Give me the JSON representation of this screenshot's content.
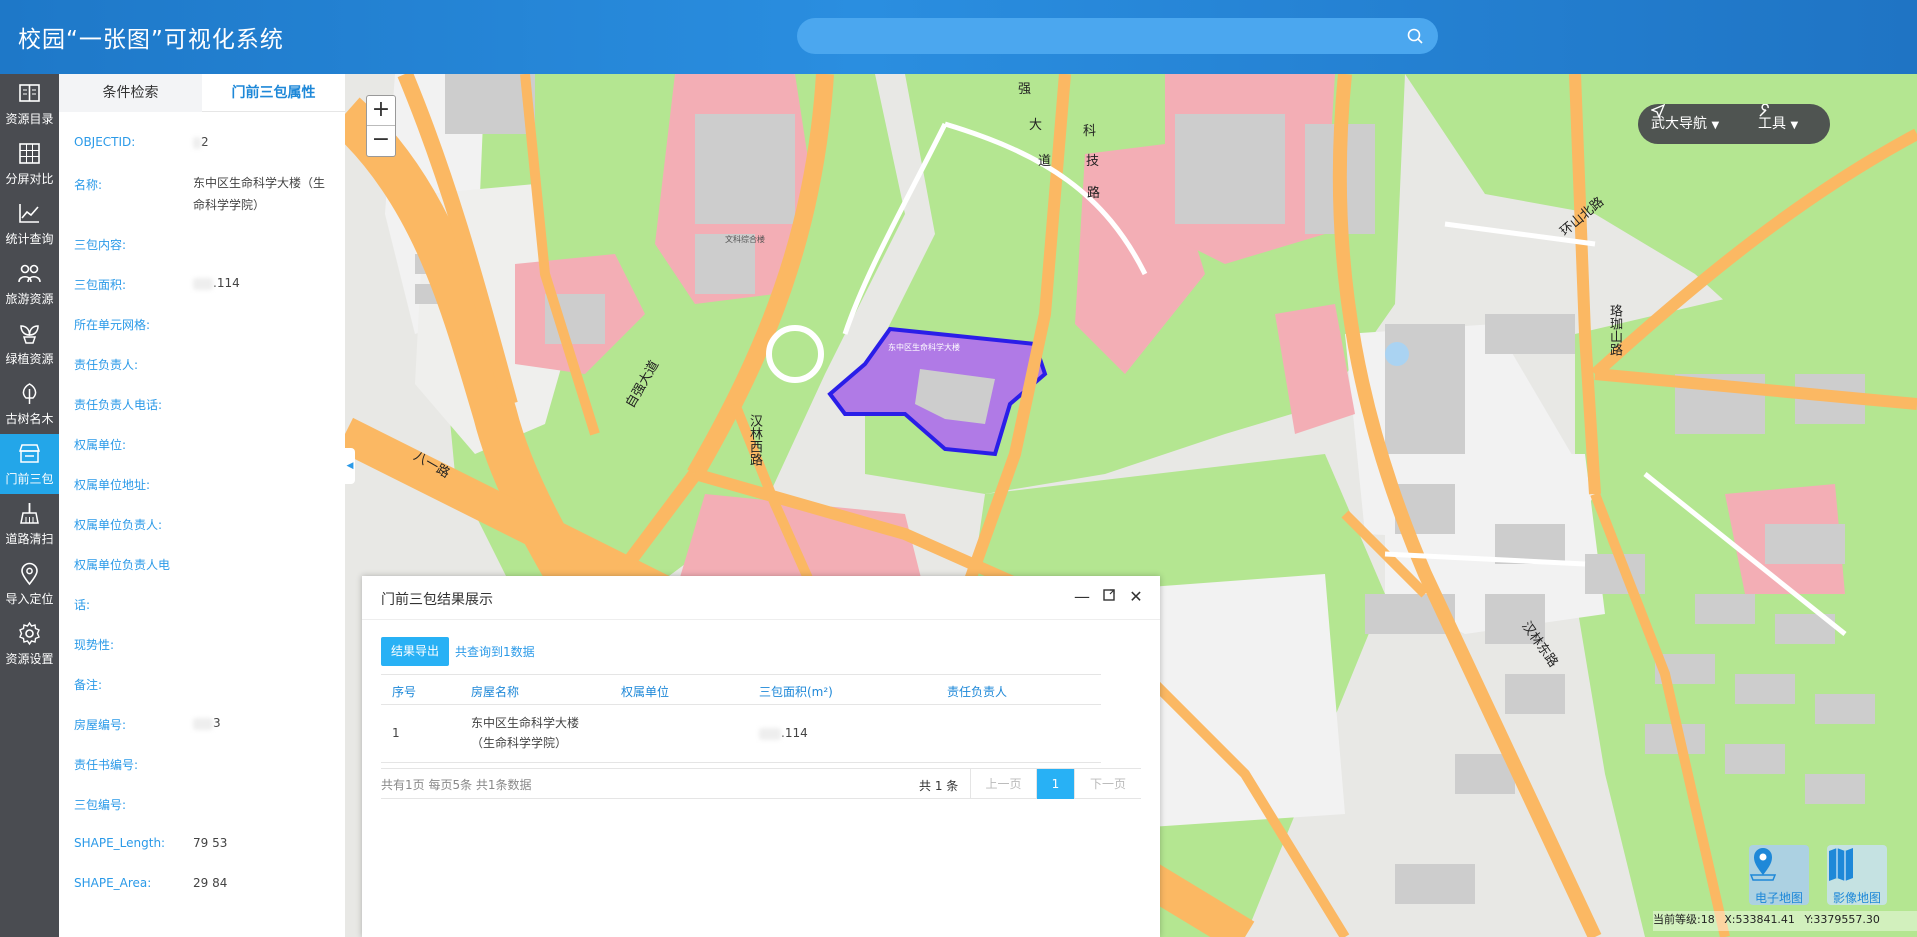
{
  "header": {
    "title": "校园“一张图”可视化系统",
    "search_placeholder": "",
    "search_icon": "search-icon"
  },
  "nav": {
    "items": [
      {
        "label": "资源目录",
        "icon": "book-icon",
        "active": false
      },
      {
        "label": "分屏对比",
        "icon": "grid-icon",
        "active": false
      },
      {
        "label": "统计查询",
        "icon": "line-chart-icon",
        "active": false
      },
      {
        "label": "旅游资源",
        "icon": "people-icon",
        "active": false
      },
      {
        "label": "绿植资源",
        "icon": "plant-icon",
        "active": false
      },
      {
        "label": "古树名木",
        "icon": "tree-icon",
        "active": false
      },
      {
        "label": "门前三包",
        "icon": "storefront-icon",
        "active": true
      },
      {
        "label": "道路清扫",
        "icon": "broom-icon",
        "active": false
      },
      {
        "label": "导入定位",
        "icon": "location-pin-icon",
        "active": false
      },
      {
        "label": "资源设置",
        "icon": "gear-icon",
        "active": false
      }
    ]
  },
  "panel": {
    "tabs": [
      "条件检索",
      "门前三包属性"
    ],
    "active_tab": 1,
    "rows": [
      {
        "key": "OBJECTID:",
        "value": "2"
      },
      {
        "key": "名称:",
        "value": "东中区生命科学大楼（生命科学学院）"
      },
      {
        "key": "三包内容:",
        "value": ""
      },
      {
        "key": "三包面积:",
        "value": ".114"
      },
      {
        "key": "所在单元网格:",
        "value": ""
      },
      {
        "key": "责任负责人:",
        "value": ""
      },
      {
        "key": "责任负责人电话:",
        "value": ""
      },
      {
        "key": "权属单位:",
        "value": ""
      },
      {
        "key": "权属单位地址:",
        "value": ""
      },
      {
        "key": "权属单位负责人:",
        "value": ""
      },
      {
        "key": "权属单位负责人电",
        "value": ""
      },
      {
        "key": "话:",
        "value": ""
      },
      {
        "key": "现势性:",
        "value": ""
      },
      {
        "key": "备注:",
        "value": ""
      },
      {
        "key": "房屋编号:",
        "value": "3"
      },
      {
        "key": "责任书编号:",
        "value": ""
      },
      {
        "key": "三包编号:",
        "value": ""
      },
      {
        "key": "SHAPE_Length:",
        "value": "79  53"
      },
      {
        "key": "SHAPE_Area:",
        "value": "29  84"
      }
    ]
  },
  "map": {
    "toolbar": {
      "nav_label": "武大导航",
      "tool_label": "工具"
    },
    "basemaps": [
      {
        "label": "电子地图",
        "icon": "map-pin-icon"
      },
      {
        "label": "影像地图",
        "icon": "folded-map-icon"
      }
    ],
    "status": {
      "level": "当前等级:18",
      "x": "X:533841.41",
      "y": "Y:3379557.30"
    },
    "labels": [
      {
        "text": "强",
        "name": "road-label-qiang"
      },
      {
        "text": "大",
        "name": "road-label-da"
      },
      {
        "text": "道",
        "name": "road-label-dao"
      },
      {
        "text": "科",
        "name": "road-label-ke"
      },
      {
        "text": "技",
        "name": "road-label-ji"
      },
      {
        "text": "路",
        "name": "road-label-lu"
      },
      {
        "text": "环山北路",
        "name": "road-label-huanshan"
      },
      {
        "text": "珞珈山路",
        "name": "road-label-luojia"
      },
      {
        "text": "八一路",
        "name": "road-label-bayi"
      },
      {
        "text": "汉林西路",
        "name": "road-label-hanlinxi"
      },
      {
        "text": "汉林东路",
        "name": "road-label-hanlindong"
      },
      {
        "text": "自强大道",
        "name": "road-label-ziqiang"
      },
      {
        "text": "文科综合楼",
        "name": "building-label-wenke"
      },
      {
        "text": "东中区生命科学大楼",
        "name": "building-label-shengming"
      }
    ],
    "highlight_color": "#b07ae6",
    "colors": {
      "green": "#b4e691",
      "road": "#fbb863",
      "building": "#cdcdcd",
      "pink": "#f3aeb5",
      "grey": "#f2f2f2"
    }
  },
  "dialog": {
    "title": "门前三包结果展示",
    "export_label": "结果导出",
    "count_text": "共查询到1数据",
    "columns": [
      "序号",
      "房屋名称",
      "权属单位",
      "三包面积(m²)",
      "责任负责人"
    ],
    "rows": [
      {
        "no": "1",
        "name": "东中区生命科学大楼（生命科学学院）",
        "owner": "",
        "area": ".114",
        "person": ""
      }
    ],
    "pager_info": "共有1页 每页5条 共1条数据",
    "pager_total": "共 1 条",
    "prev_label": "上一页",
    "current_page": "1",
    "next_label": "下一页"
  }
}
